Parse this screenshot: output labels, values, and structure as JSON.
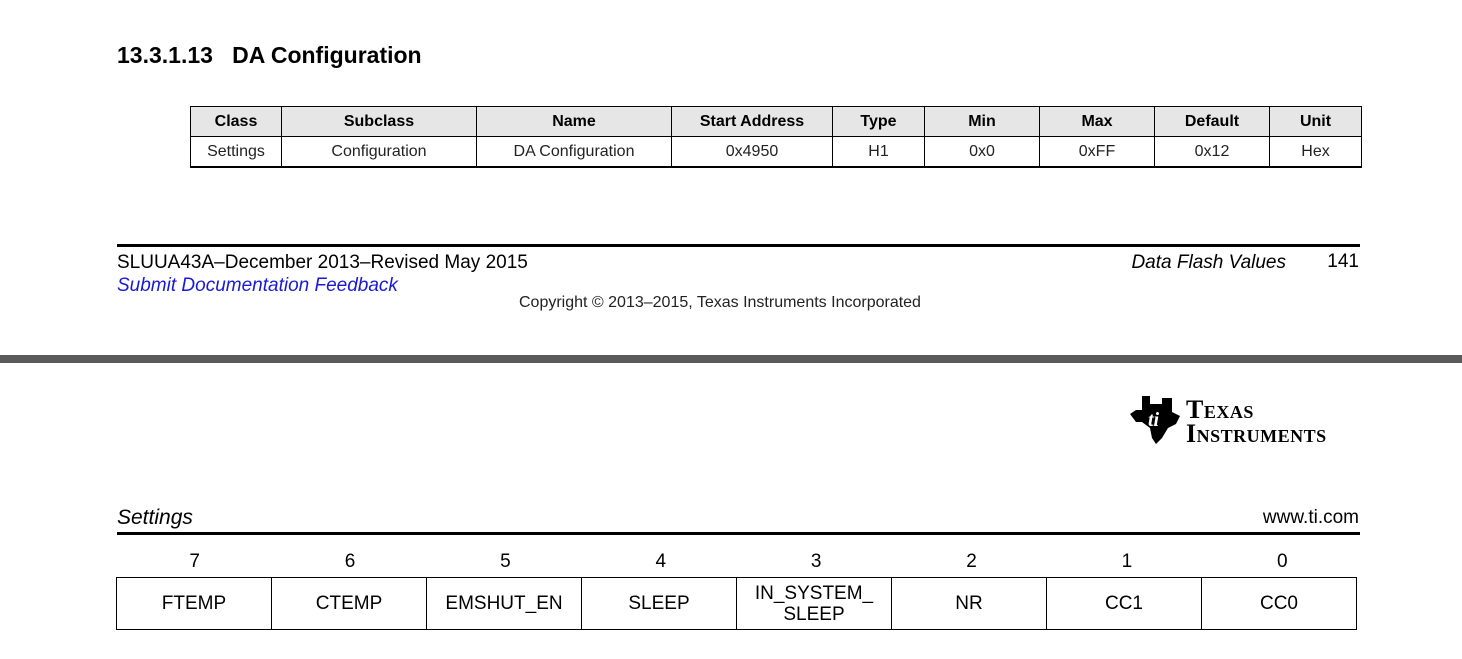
{
  "section": {
    "number": "13.3.1.13",
    "title": "DA Configuration"
  },
  "param_table": {
    "headers": [
      "Class",
      "Subclass",
      "Name",
      "Start Address",
      "Type",
      "Min",
      "Max",
      "Default",
      "Unit"
    ],
    "row": [
      "Settings",
      "Configuration",
      "DA Configuration",
      "0x4950",
      "H1",
      "0x0",
      "0xFF",
      "0x12",
      "Hex"
    ]
  },
  "footer": {
    "doc_id": "SLUUA43A–December 2013–Revised May 2015",
    "feedback_link": "Submit Documentation Feedback",
    "section_name": "Data Flash Values",
    "page_number": "141",
    "copyright": "Copyright © 2013–2015, Texas Instruments Incorporated"
  },
  "next_page": {
    "logo_line1": "Texas",
    "logo_line2": "Instruments",
    "section_label": "Settings",
    "url": "www.ti.com",
    "bit_numbers": [
      "7",
      "6",
      "5",
      "4",
      "3",
      "2",
      "1",
      "0"
    ],
    "bits": [
      "FTEMP",
      "CTEMP",
      "EMSHUT_EN",
      "SLEEP",
      "IN_SYSTEM_\nSLEEP",
      "NR",
      "CC1",
      "CC0"
    ]
  },
  "colors": {
    "link": "#1a1ad6",
    "header_bg": "#e6e6e6",
    "page_break": "#5a5a5a"
  }
}
